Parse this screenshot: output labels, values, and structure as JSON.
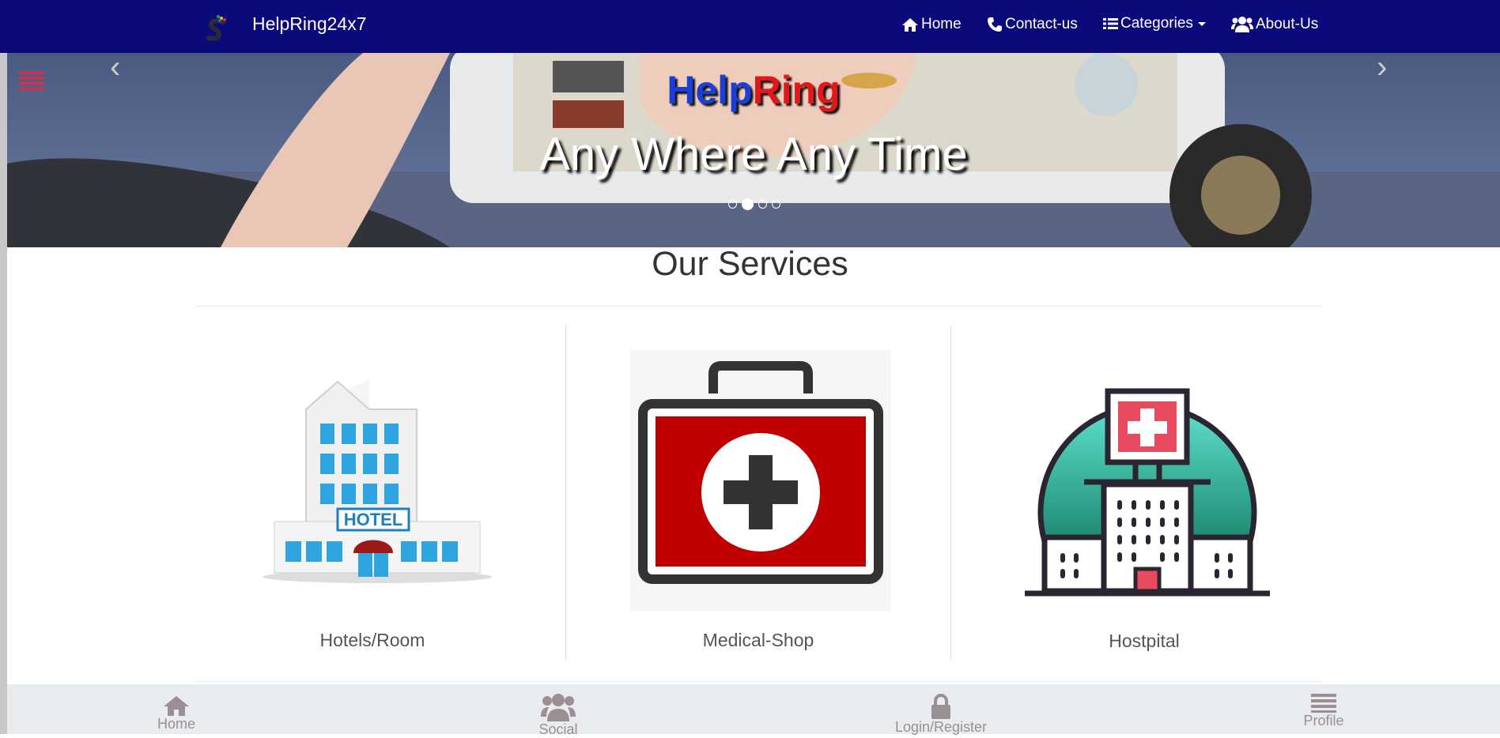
{
  "navbar": {
    "brand": "HelpRing24x7",
    "links": {
      "home": "Home",
      "contact": "Contact-us",
      "categories": "Categories",
      "about": "About-Us"
    },
    "background": "#0b0a7a"
  },
  "hero": {
    "title_part1": "Help",
    "title_part2": "Ring",
    "subtitle": "Any Where Any Time",
    "slide_count": 4,
    "active_slide": 2
  },
  "services": {
    "title": "Our Services",
    "items": [
      {
        "label": "Hotels/Room",
        "icon": "hotel-icon"
      },
      {
        "label": "Medical-Shop",
        "icon": "medical-kit-icon"
      },
      {
        "label": "Hostpital",
        "icon": "hospital-icon"
      }
    ]
  },
  "bottom_nav": {
    "home": "Home",
    "social": "Social",
    "login": "Login/Register",
    "profile": "Profile"
  },
  "colors": {
    "brand_blue": "#1a3fd6",
    "brand_red": "#e01818",
    "menu_accent": "#d0304a"
  }
}
